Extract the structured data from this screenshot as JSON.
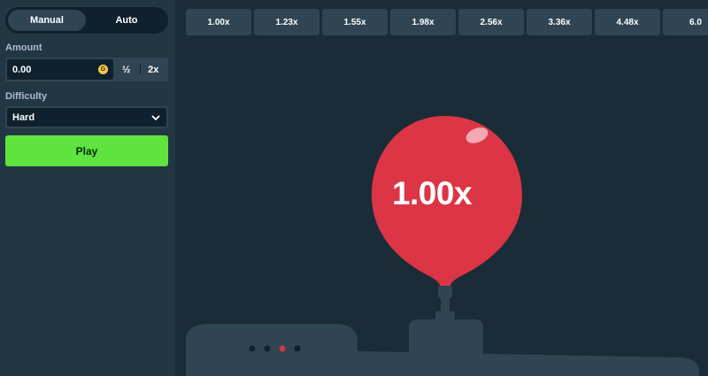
{
  "sidebar": {
    "mode_tabs": [
      {
        "label": "Manual",
        "active": true
      },
      {
        "label": "Auto",
        "active": false
      }
    ],
    "amount": {
      "label": "Amount",
      "value": "0.00",
      "currency_badge": "G",
      "half_label": "½",
      "double_label": "2x"
    },
    "difficulty": {
      "label": "Difficulty",
      "value": "Hard"
    },
    "play_label": "Play"
  },
  "multipliers": [
    "1.00x",
    "1.23x",
    "1.55x",
    "1.98x",
    "2.56x",
    "3.36x",
    "4.48x",
    "6.0"
  ],
  "balloon": {
    "multiplier": "1.00x",
    "color": "#dc3545"
  },
  "pump_dots": {
    "count": 4,
    "active_index": 2,
    "active_color": "#dc3545",
    "inactive_color": "#0f212e"
  },
  "colors": {
    "sidebar": "#213743",
    "main": "#1a2c38",
    "play": "#5fe33f",
    "chip": "#2f4553"
  }
}
